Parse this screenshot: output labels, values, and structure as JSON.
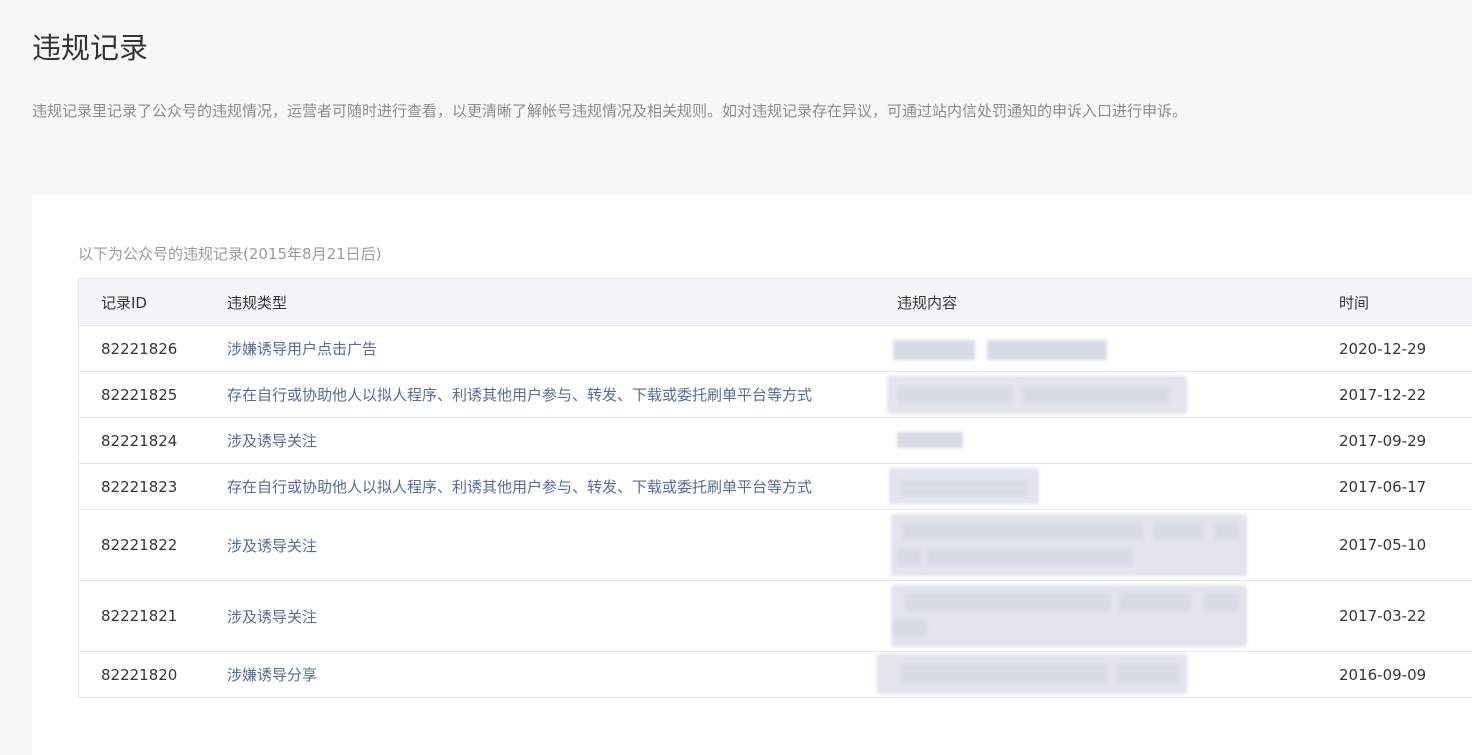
{
  "page": {
    "title": "违规记录",
    "description": "违规记录里记录了公众号的违规情况，运营者可随时进行查看，以更清晰了解帐号违规情况及相关规则。如对违规记录存在异议，可通过站内信处罚通知的申诉入口进行申诉。"
  },
  "table": {
    "caption": "以下为公众号的违规记录(2015年8月21日后)",
    "headers": {
      "id": "记录ID",
      "type": "违规类型",
      "content": "违规内容",
      "time": "时间"
    },
    "rows": [
      {
        "id": "82221826",
        "type": "涉嫌诱导用户点击广告",
        "time": "2020-12-29"
      },
      {
        "id": "82221825",
        "type": "存在自行或协助他人以拟人程序、利诱其他用户参与、转发、下载或委托刷单平台等方式",
        "time": "2017-12-22"
      },
      {
        "id": "82221824",
        "type": "涉及诱导关注",
        "time": "2017-09-29"
      },
      {
        "id": "82221823",
        "type": "存在自行或协助他人以拟人程序、利诱其他用户参与、转发、下载或委托刷单平台等方式",
        "time": "2017-06-17"
      },
      {
        "id": "82221822",
        "type": "涉及诱导关注",
        "time": "2017-05-10"
      },
      {
        "id": "82221821",
        "type": "涉及诱导关注",
        "time": "2017-03-22"
      },
      {
        "id": "82221820",
        "type": "涉嫌诱导分享",
        "time": "2016-09-09"
      }
    ]
  },
  "colors": {
    "background": "#f6f7f9",
    "link": "#576b95",
    "header_bg": "#f4f5f9"
  }
}
